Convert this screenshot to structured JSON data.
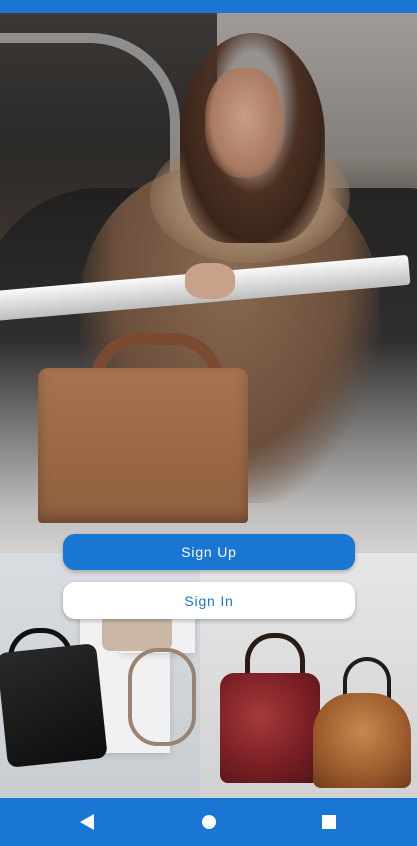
{
  "theme": {
    "accent": "#1976d2",
    "button_secondary_bg": "#ffffff"
  },
  "auth": {
    "signup_label": "Sign Up",
    "signin_label": "Sign In"
  },
  "navigation": {
    "back_icon": "back-triangle-icon",
    "home_icon": "home-circle-icon",
    "recents_icon": "recents-square-icon"
  }
}
